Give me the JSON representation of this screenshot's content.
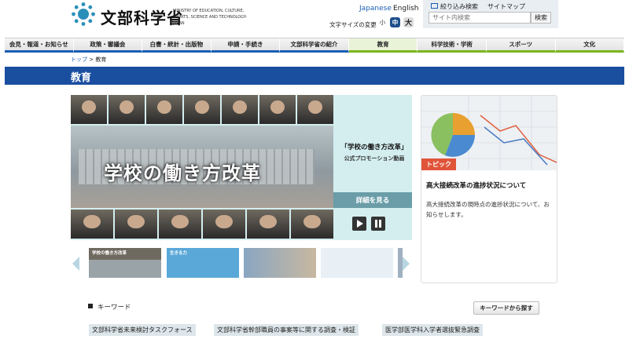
{
  "header": {
    "logo_title": "文部科学省",
    "logo_en": "MINISTRY OF EDUCATION, CULTURE, SPORTS, SCIENCE AND TECHNOLOGY-JAPAN",
    "lang_ja": "Japanese",
    "lang_en": "English",
    "font_size_label": "文字サイズの変更",
    "font_small": "小",
    "font_mid": "中",
    "font_big": "大",
    "filter_search": "絞り込み検索",
    "sitemap": "サイトマップ",
    "search_placeholder": "サイト内検索",
    "search_button": "検索"
  },
  "nav": {
    "items": [
      {
        "label": "会見・報道・お知らせ"
      },
      {
        "label": "政策・審議会"
      },
      {
        "label": "白書・統計・出版物"
      },
      {
        "label": "申請・手続き"
      },
      {
        "label": "文部科学省の紹介"
      },
      {
        "label": "教育"
      },
      {
        "label": "科学技術・学術"
      },
      {
        "label": "スポーツ"
      },
      {
        "label": "文化"
      }
    ]
  },
  "breadcrumb": {
    "top": "トップ",
    "sep": " > ",
    "current": "教育"
  },
  "page_title": "教育",
  "hero": {
    "main_text": "学校の働き方改革",
    "sub1": "「学校の働き方改革」",
    "sub2": "公式プロモーション動画",
    "more": "詳細を見る"
  },
  "thumbnails": [
    {
      "label": "学校の働き方改革"
    },
    {
      "label": "生きる力"
    },
    {
      "label": ""
    },
    {
      "label": ""
    }
  ],
  "topic": {
    "tag": "トピック",
    "title": "高大接続改革の進捗状況について",
    "desc": "高大接続改革の現時点の進捗状況について、お知らせします。"
  },
  "keywords": {
    "heading": "キーワード",
    "search_button": "キーワードから探す",
    "tags": [
      "文部科学省未来検討タスクフォース",
      "文部科学省幹部職員の事案等に関する調査・検証",
      "医学部医学科入学者選抜緊急調査"
    ]
  },
  "colors": {
    "brand_blue": "#1a4fa0",
    "nav_green": "#7ab51d",
    "topic_tag": "#e0543a",
    "hero_bg": "#d4eef0"
  }
}
